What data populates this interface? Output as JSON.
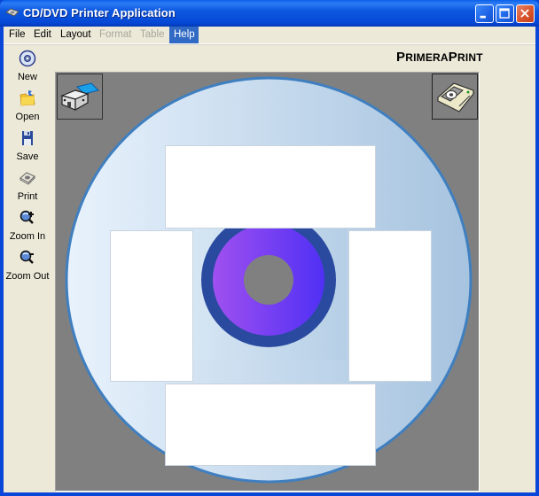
{
  "window": {
    "title": "CD/DVD Printer Application",
    "controls": [
      "minimize",
      "maximize",
      "close"
    ]
  },
  "menubar": {
    "items": [
      {
        "label": "File",
        "enabled": true
      },
      {
        "label": "Edit",
        "enabled": true
      },
      {
        "label": "Layout",
        "enabled": true
      },
      {
        "label": "Format",
        "enabled": false
      },
      {
        "label": "Table",
        "enabled": false
      },
      {
        "label": "Help",
        "enabled": true,
        "highlighted": true
      }
    ]
  },
  "toolbar": {
    "items": [
      {
        "label": "New",
        "icon": "cd-disc-icon"
      },
      {
        "label": "Open",
        "icon": "open-folder-icon"
      },
      {
        "label": "Save",
        "icon": "floppy-disk-icon"
      },
      {
        "label": "Print",
        "icon": "printer-icon"
      },
      {
        "label": "Zoom In",
        "icon": "zoom-in-icon"
      },
      {
        "label": "Zoom Out",
        "icon": "zoom-out-icon"
      }
    ]
  },
  "brand": {
    "part1_cap": "P",
    "part1_rest": "RIMERA",
    "part2_cap": "P",
    "part2_rest": "RINT"
  },
  "canvas": {
    "left_button_icon": "disc-tray-eject-icon",
    "right_button_icon": "disc-printer-icon",
    "disc": {
      "text_boxes": [
        "top",
        "left",
        "right",
        "bottom"
      ],
      "colors": {
        "canvas_bg": "#808080",
        "disc_edge": "#3f7fc0",
        "disc_fill_light": "#e6f0fa",
        "disc_fill_dark": "#a7c4e0",
        "hub_ring": "#2a4aa0",
        "hub_fill_left": "#9950f0",
        "hub_fill_right": "#5530f0",
        "hole": "#808080"
      }
    }
  }
}
